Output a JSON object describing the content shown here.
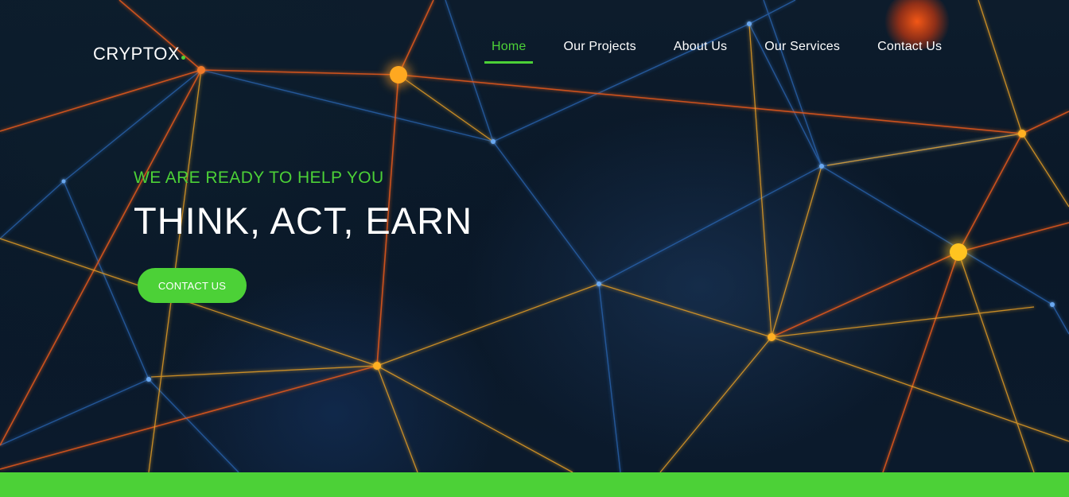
{
  "brand": {
    "name": "CRYPTOX",
    "accent_color": "#4cd137"
  },
  "nav": {
    "items": [
      {
        "label": "Home",
        "active": true
      },
      {
        "label": "Our Projects",
        "active": false
      },
      {
        "label": "About Us",
        "active": false
      },
      {
        "label": "Our Services",
        "active": false
      },
      {
        "label": "Contact Us",
        "active": false
      }
    ]
  },
  "hero": {
    "tagline": "WE ARE READY TO HELP YOU",
    "headline": "THINK, ACT, EARN",
    "cta_label": "CONTACT US",
    "background": "network-graph-illustration",
    "line_colors": [
      "#e8621f",
      "#f0a020",
      "#2f6fc0"
    ]
  }
}
